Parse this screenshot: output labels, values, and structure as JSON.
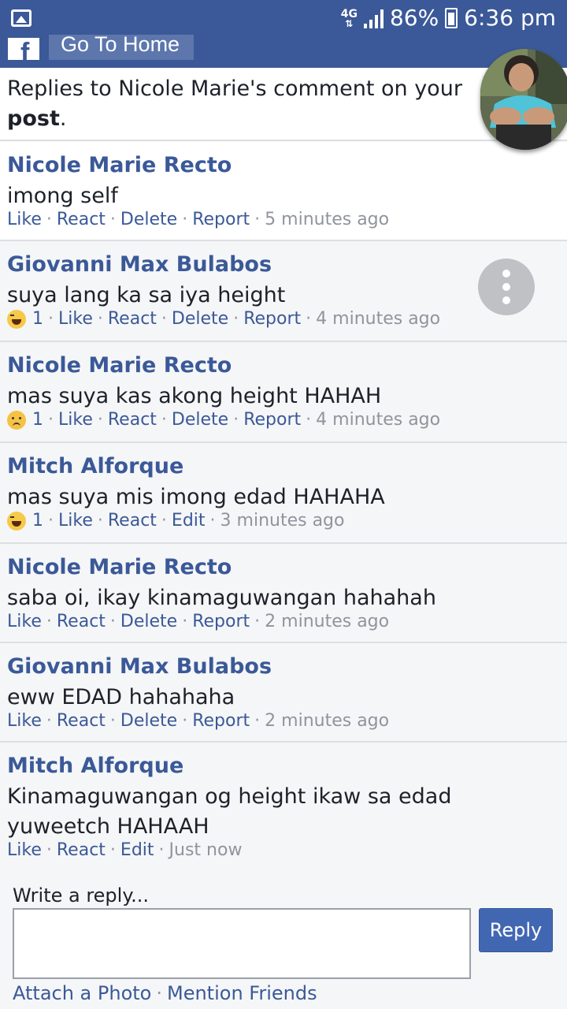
{
  "status_bar": {
    "network": "4G",
    "battery": "86%",
    "time": "6:36 pm",
    "icons": [
      "image-icon",
      "signal-icon",
      "battery-icon"
    ]
  },
  "header": {
    "logo": "f",
    "go_home_label": "Go To Home"
  },
  "title": {
    "prefix": "Replies to Nicole Marie's comment on your",
    "bold": "post",
    "suffix": "."
  },
  "comments": [
    {
      "author": "Nicole Marie Recto",
      "text": "imong self",
      "reaction_count": "",
      "actions": [
        "Like",
        "React",
        "Delete",
        "Report"
      ],
      "time": "5 minutes ago"
    },
    {
      "author": "Giovanni Max Bulabos",
      "text": "suya lang ka sa iya height",
      "reaction": "haha",
      "reaction_count": "1",
      "actions": [
        "Like",
        "React",
        "Delete",
        "Report"
      ],
      "time": "4 minutes ago"
    },
    {
      "author": "Nicole Marie Recto",
      "text": "mas suya kas akong height HAHAH",
      "reaction": "sad",
      "reaction_count": "1",
      "actions": [
        "Like",
        "React",
        "Delete",
        "Report"
      ],
      "time": "4 minutes ago"
    },
    {
      "author": "Mitch Alforque",
      "text": "mas suya mis imong edad HAHAHA",
      "reaction": "haha",
      "reaction_count": "1",
      "actions": [
        "Like",
        "React",
        "Edit"
      ],
      "time": "3 minutes ago"
    },
    {
      "author": "Nicole Marie Recto",
      "text": "saba oi, ikay kinamaguwangan hahahah",
      "reaction_count": "",
      "actions": [
        "Like",
        "React",
        "Delete",
        "Report"
      ],
      "time": "2 minutes ago"
    },
    {
      "author": "Giovanni Max Bulabos",
      "text": "eww EDAD hahahaha",
      "reaction_count": "",
      "actions": [
        "Like",
        "React",
        "Delete",
        "Report"
      ],
      "time": "2 minutes ago"
    },
    {
      "author": "Mitch Alforque",
      "text_line1": "Kinamaguwangan og height ikaw sa edad",
      "text_line2": "yuweetch HAHAAH",
      "reaction_count": "",
      "actions": [
        "Like",
        "React",
        "Edit"
      ],
      "time": "Just now"
    }
  ],
  "reply": {
    "label": "Write a reply...",
    "input_value": "",
    "button_label": "Reply",
    "attach_photo": "Attach a Photo",
    "mention_friends": "Mention Friends"
  },
  "colors": {
    "brand": "#3b5998",
    "button": "#4267b2",
    "muted": "#90949c"
  }
}
